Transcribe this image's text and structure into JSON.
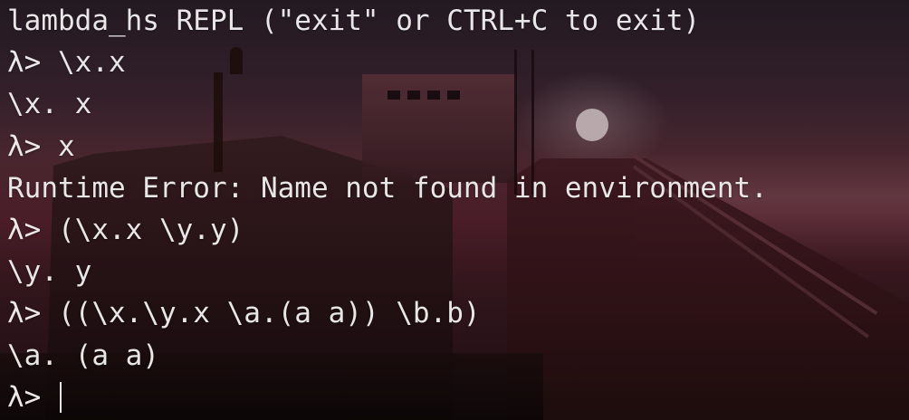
{
  "terminal": {
    "banner": "lambda_hs REPL (\"exit\" or CTRL+C to exit)",
    "prompt": "λ> ",
    "session": [
      {
        "input": "\\x.x"
      },
      {
        "output": "\\x. x"
      },
      {
        "input": "x"
      },
      {
        "output": "Runtime Error: Name not found in environment."
      },
      {
        "input": "(\\x.x \\y.y)"
      },
      {
        "output": "\\y. y"
      },
      {
        "input": "((\\x.\\y.x \\a.(a a)) \\b.b)"
      },
      {
        "output": "\\a. (a a)"
      }
    ],
    "current_input": ""
  },
  "colors": {
    "text": "#e9e6e8",
    "background_top": "#2b1f29",
    "background_mid": "#5b2432",
    "background_bottom": "#231417"
  }
}
